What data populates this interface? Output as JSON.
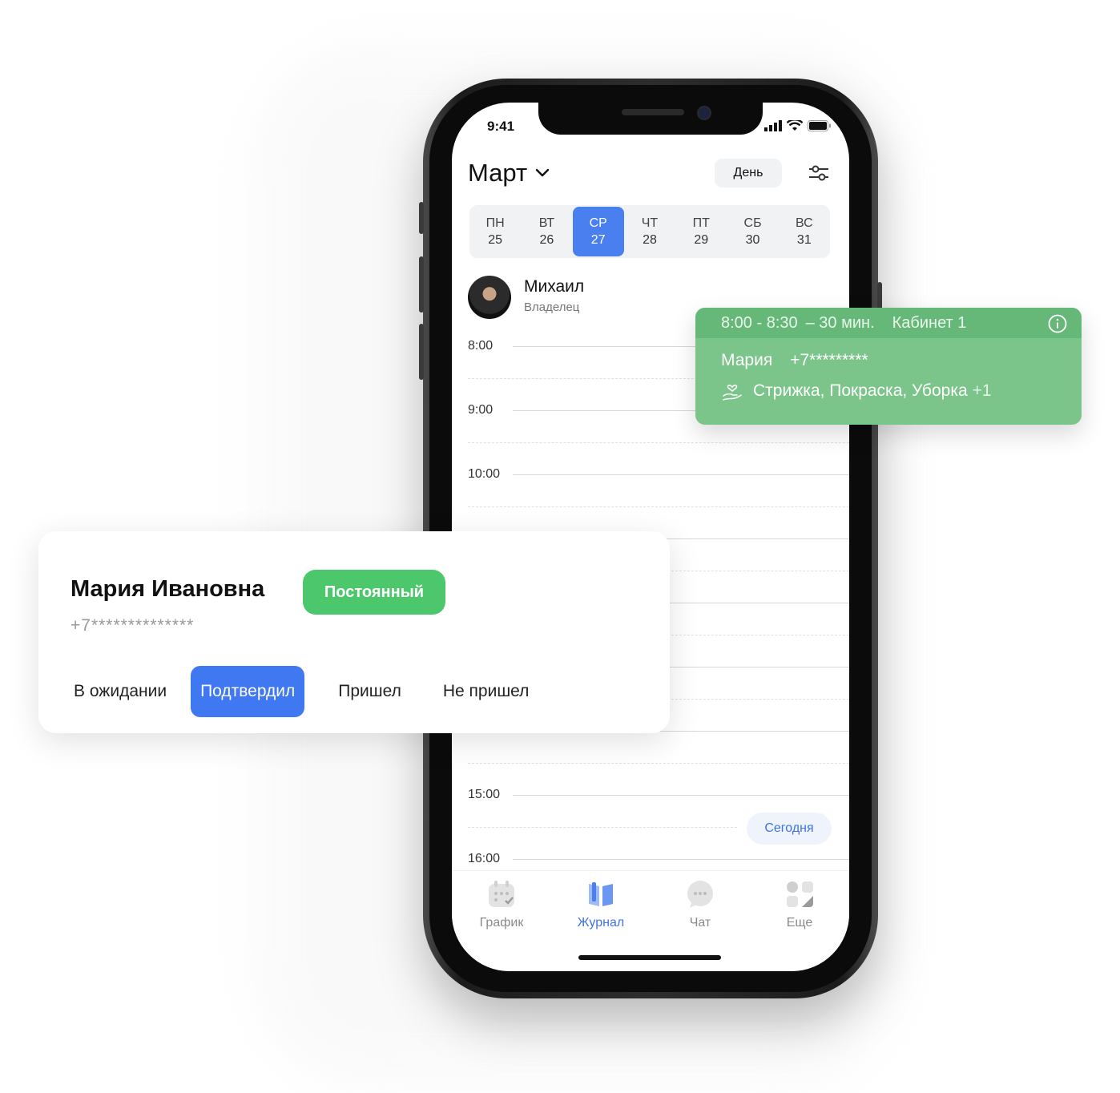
{
  "status_bar": {
    "time": "9:41"
  },
  "header": {
    "month": "Март",
    "view_label": "День"
  },
  "week": [
    {
      "day": "ПН",
      "date": "25",
      "selected": false
    },
    {
      "day": "ВТ",
      "date": "26",
      "selected": false
    },
    {
      "day": "СР",
      "date": "27",
      "selected": true
    },
    {
      "day": "ЧТ",
      "date": "28",
      "selected": false
    },
    {
      "day": "ПТ",
      "date": "29",
      "selected": false
    },
    {
      "day": "СБ",
      "date": "30",
      "selected": false
    },
    {
      "day": "ВС",
      "date": "31",
      "selected": false
    }
  ],
  "staff": {
    "name": "Михаил",
    "role": "Владелец"
  },
  "hours": [
    "8:00",
    "9:00",
    "10:00",
    "15:00",
    "16:00"
  ],
  "today_button": "Сегодня",
  "tabs": [
    {
      "label": "График",
      "icon": "calendar-icon",
      "active": false
    },
    {
      "label": "Журнал",
      "icon": "book-icon",
      "active": true
    },
    {
      "label": "Чат",
      "icon": "chat-icon",
      "active": false
    },
    {
      "label": "Еще",
      "icon": "grid-icon",
      "active": false
    }
  ],
  "appointment": {
    "time": "8:00 - 8:30",
    "duration": "– 30 мин.",
    "room": "Кабинет 1",
    "client": "Мария",
    "phone": "+7*********",
    "services": "Стрижка, Покраска, Уборка",
    "more": "+1",
    "color": "#7bc48a"
  },
  "client_card": {
    "name": "Мария Ивановна",
    "badge": "Постоянный",
    "phone": "+7**************",
    "statuses": [
      "В ожидании",
      "Подтвердил",
      "Пришел",
      "Не пришел"
    ],
    "selected_status": "Подтвердил"
  },
  "colors": {
    "accent": "#3f78f0",
    "badge": "#4cc76c"
  }
}
